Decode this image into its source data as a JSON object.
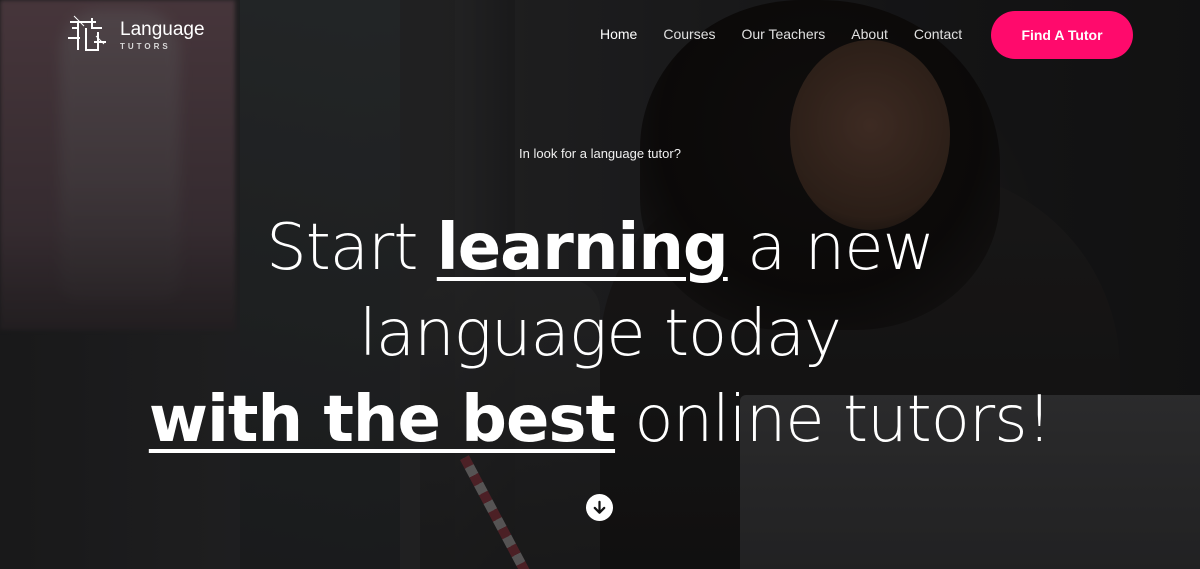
{
  "brand": {
    "title": "Language",
    "subtitle": "TUTORS"
  },
  "nav": {
    "items": [
      {
        "label": "Home",
        "active": true
      },
      {
        "label": "Courses",
        "active": false
      },
      {
        "label": "Our Teachers",
        "active": false
      },
      {
        "label": "About",
        "active": false
      },
      {
        "label": "Contact",
        "active": false
      }
    ]
  },
  "cta": {
    "label": "Find A Tutor",
    "color": "#ff0a6c"
  },
  "hero": {
    "kicker": "In look for a language tutor?",
    "line1_pre": "Start ",
    "line1_bold": "learning",
    "line1_post": " a new",
    "line2": "language today",
    "line3_bold": "with the best",
    "line3_post": " online tutors!"
  },
  "icons": {
    "scroll": "arrow-down-circle-icon",
    "logo": "logo-icon"
  }
}
